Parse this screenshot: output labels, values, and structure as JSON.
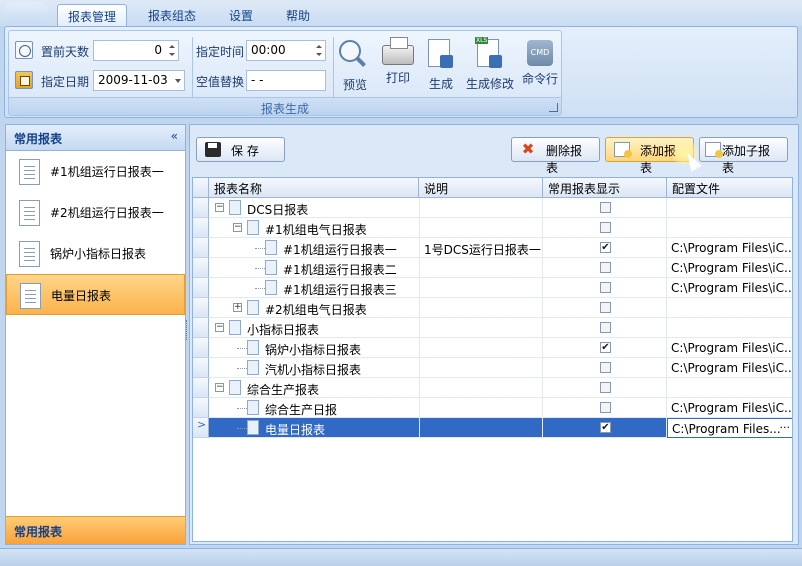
{
  "ribbon": {
    "tabs": [
      "报表管理",
      "报表组态",
      "设置",
      "帮助"
    ],
    "active_tab": 0,
    "group_caption": "报表生成",
    "fields": {
      "days_label": "置前天数",
      "days_value": "0",
      "date_label": "指定日期",
      "date_value": "2009-11-03",
      "time_label": "指定时间",
      "time_value": "00:00",
      "null_label": "空值替换",
      "null_value": "- -"
    },
    "buttons": {
      "preview": "预览",
      "print": "打印",
      "generate": "生成",
      "generate_edit": "生成修改",
      "cmd": "命令行",
      "cmd_icon_text": "CMD"
    }
  },
  "nav": {
    "title": "常用报表",
    "collapse": "«",
    "items": [
      {
        "label": "#1机组运行日报表一"
      },
      {
        "label": "#2机组运行日报表一"
      },
      {
        "label": "锅炉小指标日报表"
      },
      {
        "label": "电量日报表"
      }
    ],
    "active_index": 3,
    "footer": "常用报表"
  },
  "toolbar": {
    "save": "保  存",
    "delete": "删除报表",
    "add": "添加报表",
    "add_child": "添加子报表"
  },
  "grid": {
    "columns": [
      "报表名称",
      "说明",
      "常用报表显示",
      "配置文件"
    ],
    "rows": [
      {
        "name": "DCS日报表",
        "desc": "",
        "checked": false,
        "config": ""
      },
      {
        "name": "#1机组电气日报表",
        "desc": "",
        "checked": false,
        "config": ""
      },
      {
        "name": "#1机组运行日报表一",
        "desc": "1号DCS运行日报表一",
        "checked": true,
        "config": "C:\\Program Files\\iC..."
      },
      {
        "name": "#1机组运行日报表二",
        "desc": "",
        "checked": false,
        "config": "C:\\Program Files\\iC..."
      },
      {
        "name": "#1机组运行日报表三",
        "desc": "",
        "checked": false,
        "config": "C:\\Program Files\\iC..."
      },
      {
        "name": "#2机组电气日报表",
        "desc": "",
        "checked": false,
        "config": ""
      },
      {
        "name": "小指标日报表",
        "desc": "",
        "checked": false,
        "config": ""
      },
      {
        "name": "锅炉小指标日报表",
        "desc": "",
        "checked": true,
        "config": "C:\\Program Files\\iC..."
      },
      {
        "name": "汽机小指标日报表",
        "desc": "",
        "checked": false,
        "config": "C:\\Program Files\\iC..."
      },
      {
        "name": "综合生产报表",
        "desc": "",
        "checked": false,
        "config": ""
      },
      {
        "name": "综合生产日报",
        "desc": "",
        "checked": false,
        "config": "C:\\Program Files\\iC..."
      },
      {
        "name": "电量日报表",
        "desc": "",
        "checked": true,
        "config": "C:\\Program Files..."
      }
    ],
    "ellipsis": "···",
    "row_indicator": ">"
  }
}
